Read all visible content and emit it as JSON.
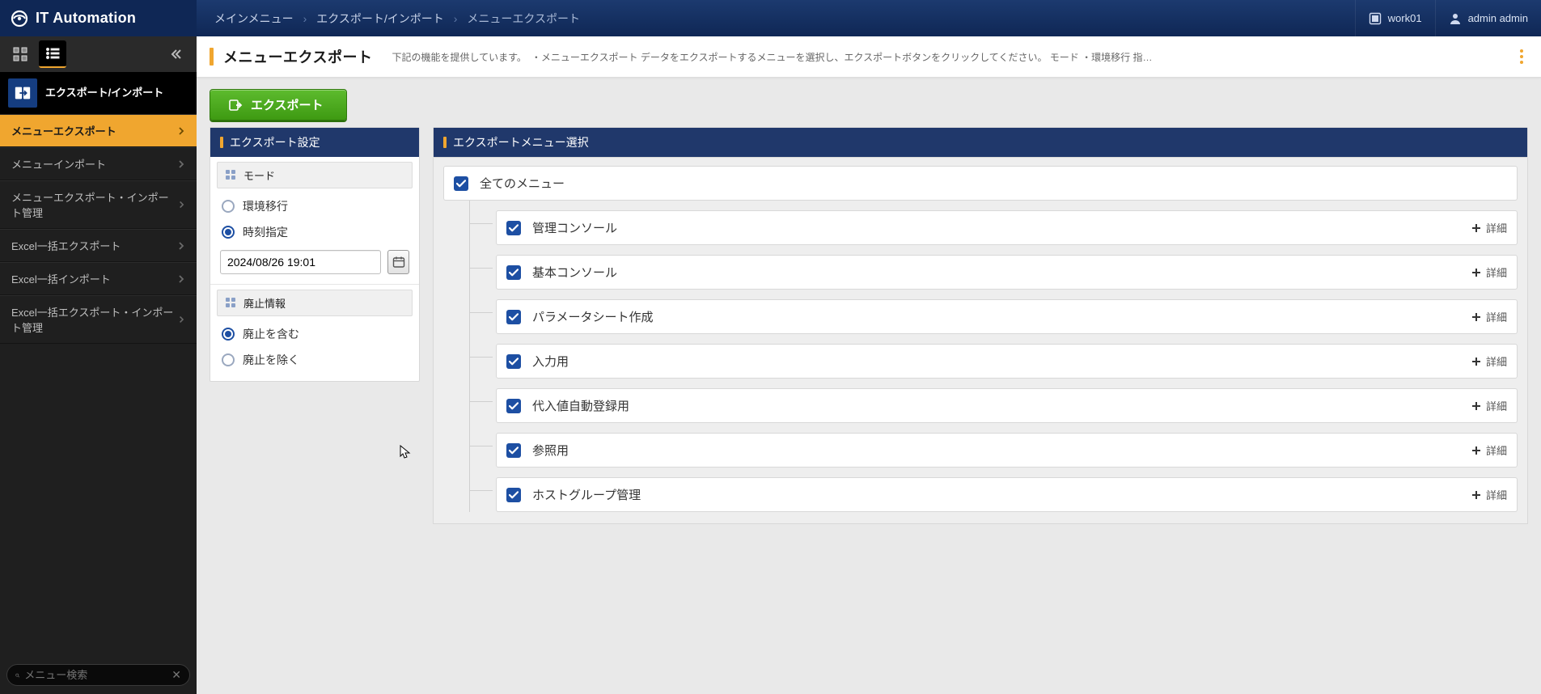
{
  "header": {
    "app_name": "IT Automation",
    "breadcrumb": [
      "メインメニュー",
      "エクスポート/インポート",
      "メニューエクスポート"
    ],
    "workspace_label": "work01",
    "user_label": "admin admin"
  },
  "sidebar": {
    "section_title": "エクスポート/インポート",
    "items": [
      {
        "label": "メニューエクスポート",
        "active": true
      },
      {
        "label": "メニューインポート",
        "active": false
      },
      {
        "label": "メニューエクスポート・インポート管理",
        "active": false
      },
      {
        "label": "Excel一括エクスポート",
        "active": false
      },
      {
        "label": "Excel一括インポート",
        "active": false
      },
      {
        "label": "Excel一括エクスポート・インポート管理",
        "active": false
      }
    ],
    "search_placeholder": "メニュー検索"
  },
  "page": {
    "title": "メニューエクスポート",
    "description": "下記の機能を提供しています。　・メニューエクスポート データをエクスポートするメニューを選択し、エクスポートボタンをクリックしてください。 モード ・環境移行 指…",
    "export_button": "エクスポート"
  },
  "settings_panel": {
    "title": "エクスポート設定",
    "mode": {
      "title": "モード",
      "options": [
        "環境移行",
        "時刻指定"
      ],
      "selected": 1,
      "datetime": "2024/08/26 19:01"
    },
    "discard": {
      "title": "廃止情報",
      "options": [
        "廃止を含む",
        "廃止を除く"
      ],
      "selected": 0
    }
  },
  "menu_select_panel": {
    "title": "エクスポートメニュー選択",
    "all_label": "全てのメニュー",
    "detail_label": "詳細",
    "groups": [
      {
        "label": "管理コンソール"
      },
      {
        "label": "基本コンソール"
      },
      {
        "label": "パラメータシート作成"
      },
      {
        "label": "入力用"
      },
      {
        "label": "代入値自動登録用"
      },
      {
        "label": "参照用"
      },
      {
        "label": "ホストグループ管理"
      }
    ]
  }
}
